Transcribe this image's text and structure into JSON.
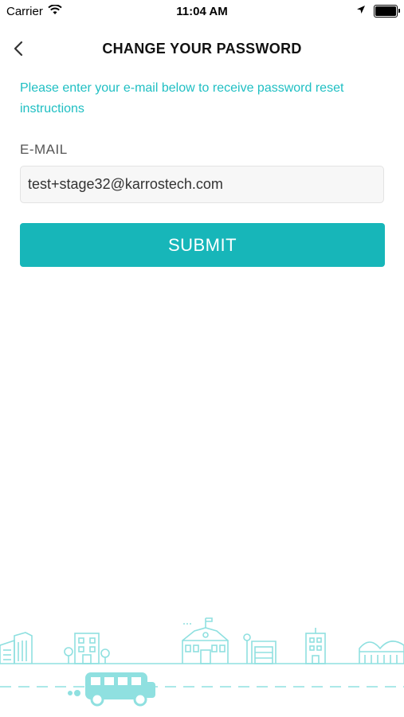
{
  "status_bar": {
    "carrier": "Carrier",
    "time": "11:04 AM"
  },
  "header": {
    "title": "CHANGE YOUR PASSWORD"
  },
  "form": {
    "instructions": "Please enter your e-mail below to receive password reset instructions",
    "email_label": "E-MAIL",
    "email_value": "test+stage32@karrostech.com",
    "submit_label": "SUBMIT"
  },
  "icons": {
    "back": "chevron-left-icon",
    "wifi": "wifi-icon",
    "location": "location-arrow-icon",
    "battery": "battery-icon"
  },
  "colors": {
    "accent": "#1fbfc3",
    "button": "#17b6b9",
    "illustration": "#8fe0e0"
  }
}
